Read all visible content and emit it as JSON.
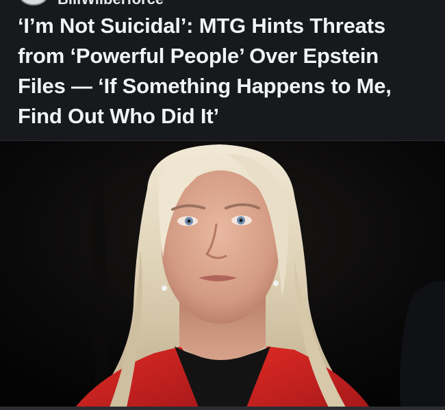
{
  "post": {
    "source_name": "BillWilberforce",
    "headline": "‘I’m Not Suicidal’: MTG Hints Threats from ‘Powerful People’ Over Epstein Files — ‘If Something Happens to Me, Find Out Who Did It’"
  },
  "photo": {
    "subject": "portrait-photo",
    "colors": {
      "background": "#050608",
      "hair": "#e6dcc6",
      "skin": "#d9a48c",
      "jacket": "#d0241f"
    }
  },
  "colors": {
    "card_background": "#17191c",
    "headline_text": "#f2f3f4"
  }
}
